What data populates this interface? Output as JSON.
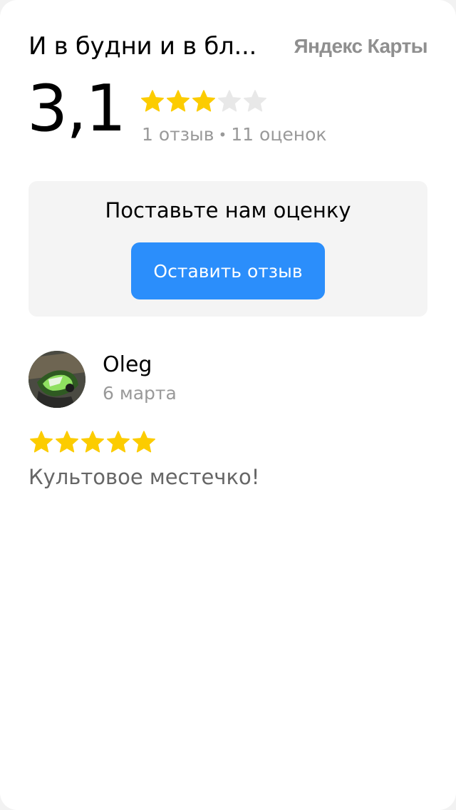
{
  "header": {
    "title": "И в будни и в бл...",
    "brand": "Яндекс Карты"
  },
  "rating": {
    "value": "3,1",
    "stars_filled": 3,
    "stars_total": 5,
    "reviews_count": "1 отзыв",
    "separator": "•",
    "ratings_count": "11 оценок"
  },
  "cta": {
    "title": "Поставьте нам оценку",
    "button_label": "Оставить отзыв"
  },
  "reviews": [
    {
      "author": "Oleg",
      "date": "6 марта",
      "stars_filled": 5,
      "text": "Культовое местечко!"
    }
  ],
  "colors": {
    "star_filled": "#fccc00",
    "star_empty": "#e8e8e8",
    "button": "#2b8efb",
    "muted_text": "#999999"
  }
}
